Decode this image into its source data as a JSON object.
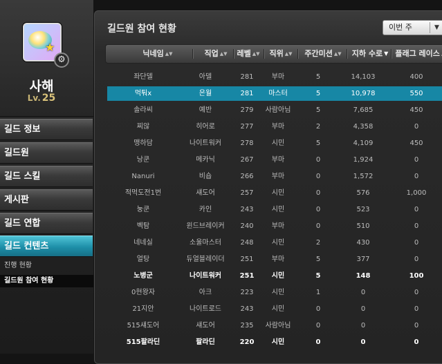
{
  "sidebar": {
    "guild_name": "사해",
    "level_label": "Lv.",
    "level_value": "25",
    "menu": [
      {
        "label": "길드 정보"
      },
      {
        "label": "길드원"
      },
      {
        "label": "길드 스킬"
      },
      {
        "label": "게시판"
      },
      {
        "label": "길드 연합"
      },
      {
        "label": "길드 컨텐츠",
        "active": true
      }
    ],
    "submenu": [
      {
        "label": "진행 현황"
      },
      {
        "label": "길드원 참여 현황",
        "active": true
      }
    ]
  },
  "panel": {
    "title": "길드원 참여 현황",
    "week_select": "이번 주"
  },
  "table": {
    "columns": [
      "닉네임",
      "직업",
      "레벨",
      "직위",
      "주간미션",
      "지하 수로",
      "플래그 레이스"
    ],
    "rows": [
      [
        "좌단델",
        "아델",
        "281",
        "부마",
        "5",
        "14,103",
        "400"
      ],
      [
        "먹퉈x",
        "은월",
        "281",
        "마스터",
        "5",
        "10,978",
        "550"
      ],
      [
        "솔라씨",
        "예반",
        "279",
        "사람아님",
        "5",
        "7,685",
        "450"
      ],
      [
        "찌않",
        "히어로",
        "277",
        "부마",
        "2",
        "4,358",
        "0"
      ],
      [
        "맹하담",
        "나이트워커",
        "278",
        "시민",
        "5",
        "4,109",
        "450"
      ],
      [
        "낭쿤",
        "메카닉",
        "267",
        "부마",
        "0",
        "1,924",
        "0"
      ],
      [
        "Nanuri",
        "비숍",
        "266",
        "부마",
        "0",
        "1,572",
        "0"
      ],
      [
        "적먹도전1번",
        "섀도어",
        "257",
        "시민",
        "0",
        "576",
        "1,000"
      ],
      [
        "눙쿤",
        "카인",
        "243",
        "시민",
        "0",
        "523",
        "0"
      ],
      [
        "벡탐",
        "윈드브레이커",
        "240",
        "부마",
        "0",
        "510",
        "0"
      ],
      [
        "네네실",
        "소울마스터",
        "248",
        "시민",
        "2",
        "430",
        "0"
      ],
      [
        "얼탕",
        "듀얼블레이더",
        "251",
        "부마",
        "5",
        "377",
        "0"
      ],
      [
        "노병군",
        "나이트워커",
        "251",
        "시민",
        "5",
        "148",
        "100"
      ],
      [
        "0현왕자",
        "아크",
        "223",
        "시민",
        "1",
        "0",
        "0"
      ],
      [
        "21지안",
        "나이트로드",
        "243",
        "시민",
        "0",
        "0",
        "0"
      ],
      [
        "515섀도어",
        "섀도어",
        "235",
        "사람아님",
        "0",
        "0",
        "0"
      ],
      [
        "515팔라딘",
        "팔라딘",
        "220",
        "시민",
        "0",
        "0",
        "0"
      ]
    ],
    "selected_row": 1,
    "bold_rows": [
      12,
      16
    ]
  },
  "colors": {
    "accent": "#1787a5",
    "active_menu": "#1d8ea8",
    "background": "#141414"
  }
}
